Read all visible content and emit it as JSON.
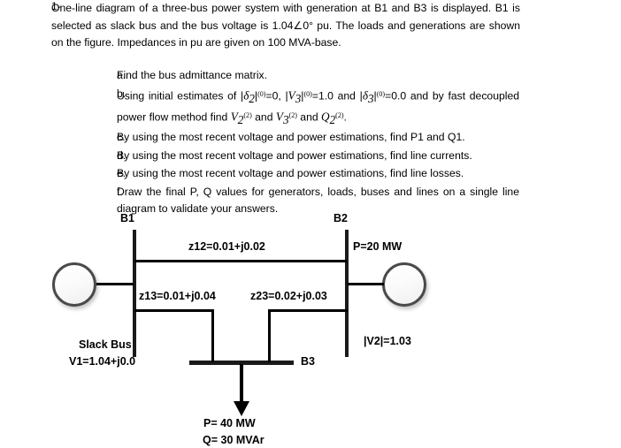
{
  "problem": {
    "number": "1-",
    "paragraph_parts": {
      "p1": "One-line diagram of a three-bus power  system with generation at B1 and B3 is displayed. B1 is selected as slack bus and the bus voltage is 1.04",
      "angle_symbol": "∠0°",
      "p2": " pu. The loads and generations are shown on the figure. Impedances in pu are given on 100 MVA-base."
    }
  },
  "sub_items": [
    {
      "letter": "a.",
      "text": "Find the bus admittance matrix."
    },
    {
      "letter": "b.",
      "segments": {
        "s1": "Using initial estimates of ",
        "m1_var": "δ",
        "m1_sub": "2",
        "m1_sup": "(0)",
        "s2": "=0, ",
        "m2_var": "V",
        "m2_sub": "3",
        "m2_sup": "(0)",
        "s3": "=1.0 and ",
        "m3_var": "δ",
        "m3_sub": "3",
        "m3_sup": "(0)",
        "s4": "=0.0 and by fast decoupled power flow method find ",
        "m4_var": "V",
        "m4_sub": "2",
        "m4_sup": "(2)",
        "s5": " and ",
        "m5_var": "V",
        "m5_sub": "3",
        "m5_sup": "(2)",
        "s6": " and ",
        "m6_var": "Q",
        "m6_sub": "2",
        "m6_sup": "(2)",
        "s7": "."
      }
    },
    {
      "letter": "c.",
      "text": "By using the most recent voltage and power estimations, find P1 and Q1."
    },
    {
      "letter": "d.",
      "text": "By using the most recent voltage and power estimations, find line currents."
    },
    {
      "letter": "e.",
      "text": "By using the most recent voltage and power estimations, find line losses."
    },
    {
      "letter": "f.",
      "text": "Draw the final P, Q values for generators, loads, buses and lines on a single line diagram to validate your answers."
    }
  ],
  "diagram": {
    "bus1_label": "B1",
    "bus2_label": "B2",
    "bus3_label": "B3",
    "line_z12": "z12=0.01+j0.02",
    "line_z13": "z13=0.01+j0.04",
    "line_z23": "z23=0.02+j0.03",
    "bus2_gen_p": "P=20 MW",
    "bus2_voltage": "|V2|=1.03",
    "slack_label": "Slack Bus",
    "slack_voltage": "V1=1.04+j0.0",
    "load_p": "P= 40 MW",
    "load_q": "Q= 30 MVAr"
  },
  "colors": {
    "background": "#ffffff",
    "text": "#000000",
    "line": "#000000",
    "busbar": "#1a1a1a",
    "generator_stroke": "#4a4a4a"
  }
}
